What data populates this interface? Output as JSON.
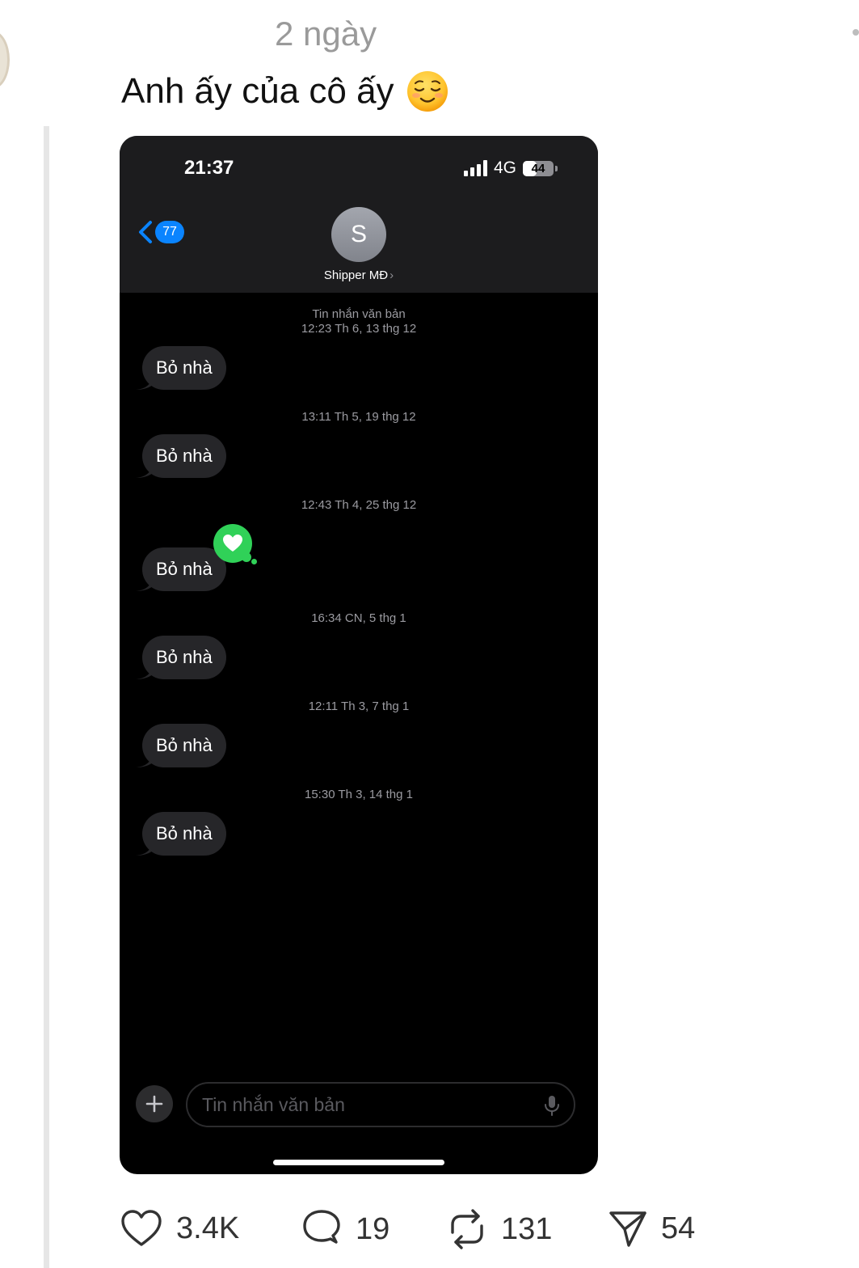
{
  "post": {
    "time": "2 ngày",
    "text": "Anh ấy của cô ấy"
  },
  "phone": {
    "status": {
      "time": "21:37",
      "network": "4G",
      "battery": "44",
      "battery_level": 0.44
    },
    "header": {
      "back_badge": "77",
      "avatar_letter": "S",
      "contact_name": "Shipper MĐ",
      "chevron": "›"
    },
    "thread": [
      {
        "stamp_line1": "Tin nhắn văn bản",
        "stamp_line2": "12:23 Th 6, 13 thg 12",
        "message": "Bỏ nhà"
      },
      {
        "stamp_line1": "13:11 Th 5, 19 thg 12",
        "message": "Bỏ nhà"
      },
      {
        "stamp_line1": "12:43 Th 4, 25 thg 12",
        "message": "Bỏ nhà",
        "tapback": "heart"
      },
      {
        "stamp_line1": "16:34 CN, 5 thg 1",
        "message": "Bỏ nhà"
      },
      {
        "stamp_line1": "12:11 Th 3, 7 thg 1",
        "message": "Bỏ nhà"
      },
      {
        "stamp_line1": "15:30 Th 3, 14 thg 1",
        "message": "Bỏ nhà"
      }
    ],
    "composer": {
      "placeholder": "Tin nhắn văn bản"
    }
  },
  "actions": {
    "likes": "3.4K",
    "replies": "19",
    "reposts": "131",
    "shares": "54"
  },
  "colors": {
    "accent": "#0a84ff",
    "bubble": "#262629",
    "tapback": "#30d158"
  },
  "icons": [
    "heart-icon",
    "reply-icon",
    "repost-icon",
    "send-icon",
    "chevron-left-icon",
    "microphone-icon",
    "plus-icon",
    "signal-icon",
    "battery-icon",
    "relieved-face-emoji"
  ]
}
